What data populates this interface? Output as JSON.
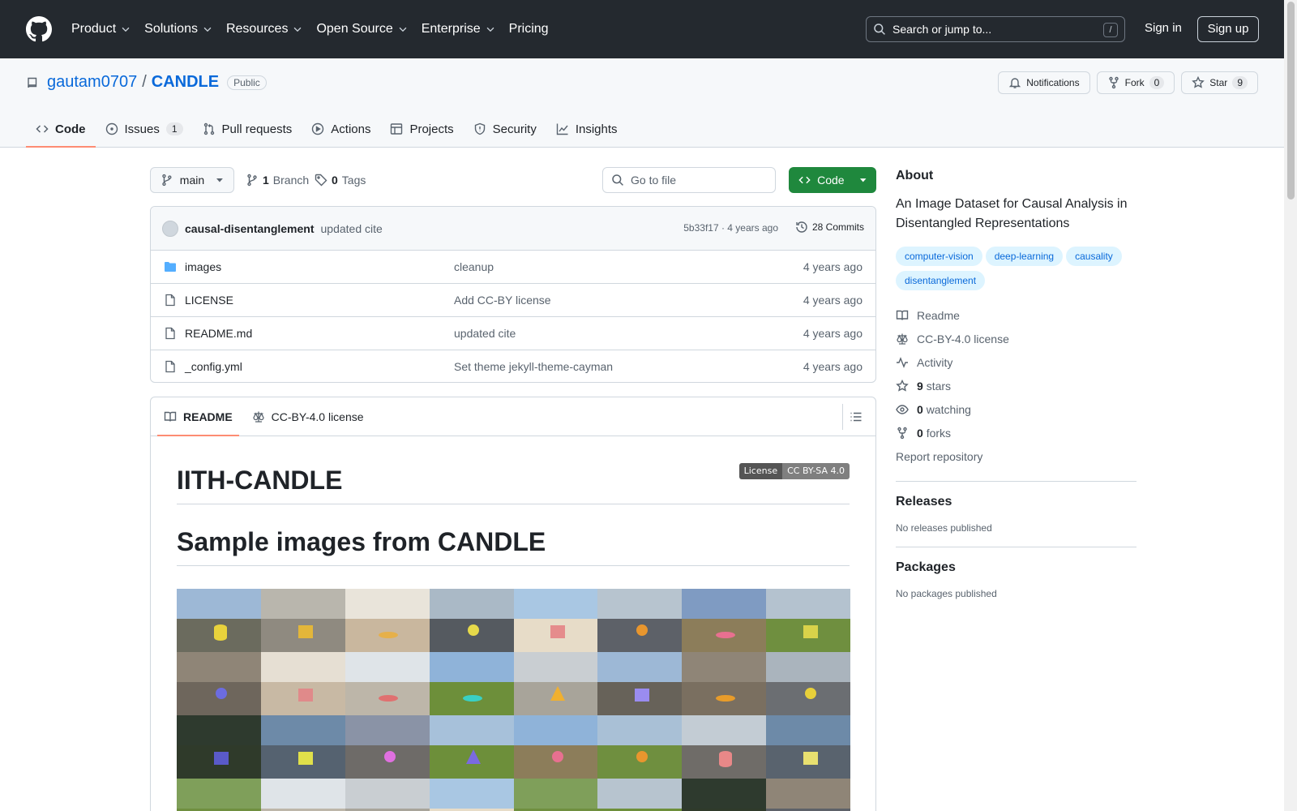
{
  "header": {
    "nav": [
      "Product",
      "Solutions",
      "Resources",
      "Open Source",
      "Enterprise",
      "Pricing"
    ],
    "search_placeholder": "Search or jump to...",
    "search_shortcut": "/",
    "sign_in": "Sign in",
    "sign_up": "Sign up"
  },
  "repo": {
    "owner": "gautam0707",
    "separator": "/",
    "name": "CANDLE",
    "visibility": "Public",
    "notifications_label": "Notifications",
    "fork_label": "Fork",
    "fork_count": "0",
    "star_label": "Star",
    "star_count": "9",
    "tabs": [
      {
        "label": "Code",
        "icon": "code-icon"
      },
      {
        "label": "Issues",
        "icon": "issue-icon",
        "count": "1"
      },
      {
        "label": "Pull requests",
        "icon": "pull-request-icon"
      },
      {
        "label": "Actions",
        "icon": "play-icon"
      },
      {
        "label": "Projects",
        "icon": "table-icon"
      },
      {
        "label": "Security",
        "icon": "shield-icon"
      },
      {
        "label": "Insights",
        "icon": "graph-icon"
      }
    ]
  },
  "toolbar": {
    "branch": "main",
    "branch_count": "1",
    "branch_label": "Branch",
    "tag_count": "0",
    "tag_label": "Tags",
    "goto_placeholder": "Go to file",
    "code_label": "Code"
  },
  "commit": {
    "author": "causal-disentanglement",
    "message": "updated cite",
    "meta": "5b33f17 · 4 years ago",
    "count": "28 Commits"
  },
  "files": [
    {
      "name": "images",
      "type": "folder",
      "message": "cleanup",
      "age": "4 years ago"
    },
    {
      "name": "LICENSE",
      "type": "file",
      "message": "Add CC-BY license",
      "age": "4 years ago"
    },
    {
      "name": "README.md",
      "type": "file",
      "message": "updated cite",
      "age": "4 years ago"
    },
    {
      "name": "_config.yml",
      "type": "file",
      "message": "Set theme jekyll-theme-cayman",
      "age": "4 years ago"
    }
  ],
  "readme": {
    "tab_readme": "README",
    "tab_license": "CC-BY-4.0 license",
    "title": "IITH-CANDLE",
    "badge_left": "License",
    "badge_right": "CC BY-SA 4.0",
    "section_title": "Sample images from CANDLE"
  },
  "about": {
    "heading": "About",
    "description": "An Image Dataset for Causal Analysis in Disentangled Representations",
    "topics": [
      "computer-vision",
      "deep-learning",
      "causality",
      "disentanglement"
    ],
    "readme_link": "Readme",
    "license_link": "CC-BY-4.0 license",
    "activity_link": "Activity",
    "stars_count": "9",
    "stars_label": "stars",
    "watching_count": "0",
    "watching_label": "watching",
    "forks_count": "0",
    "forks_label": "forks",
    "report": "Report repository"
  },
  "releases": {
    "heading": "Releases",
    "empty": "No releases published"
  },
  "packages": {
    "heading": "Packages",
    "empty": "No packages published"
  },
  "colors": {
    "header_bg": "#24292f",
    "link": "#0969da",
    "primary_button": "#1f883d",
    "tab_underline": "#fd8c73",
    "topic_bg": "#ddf4ff"
  }
}
